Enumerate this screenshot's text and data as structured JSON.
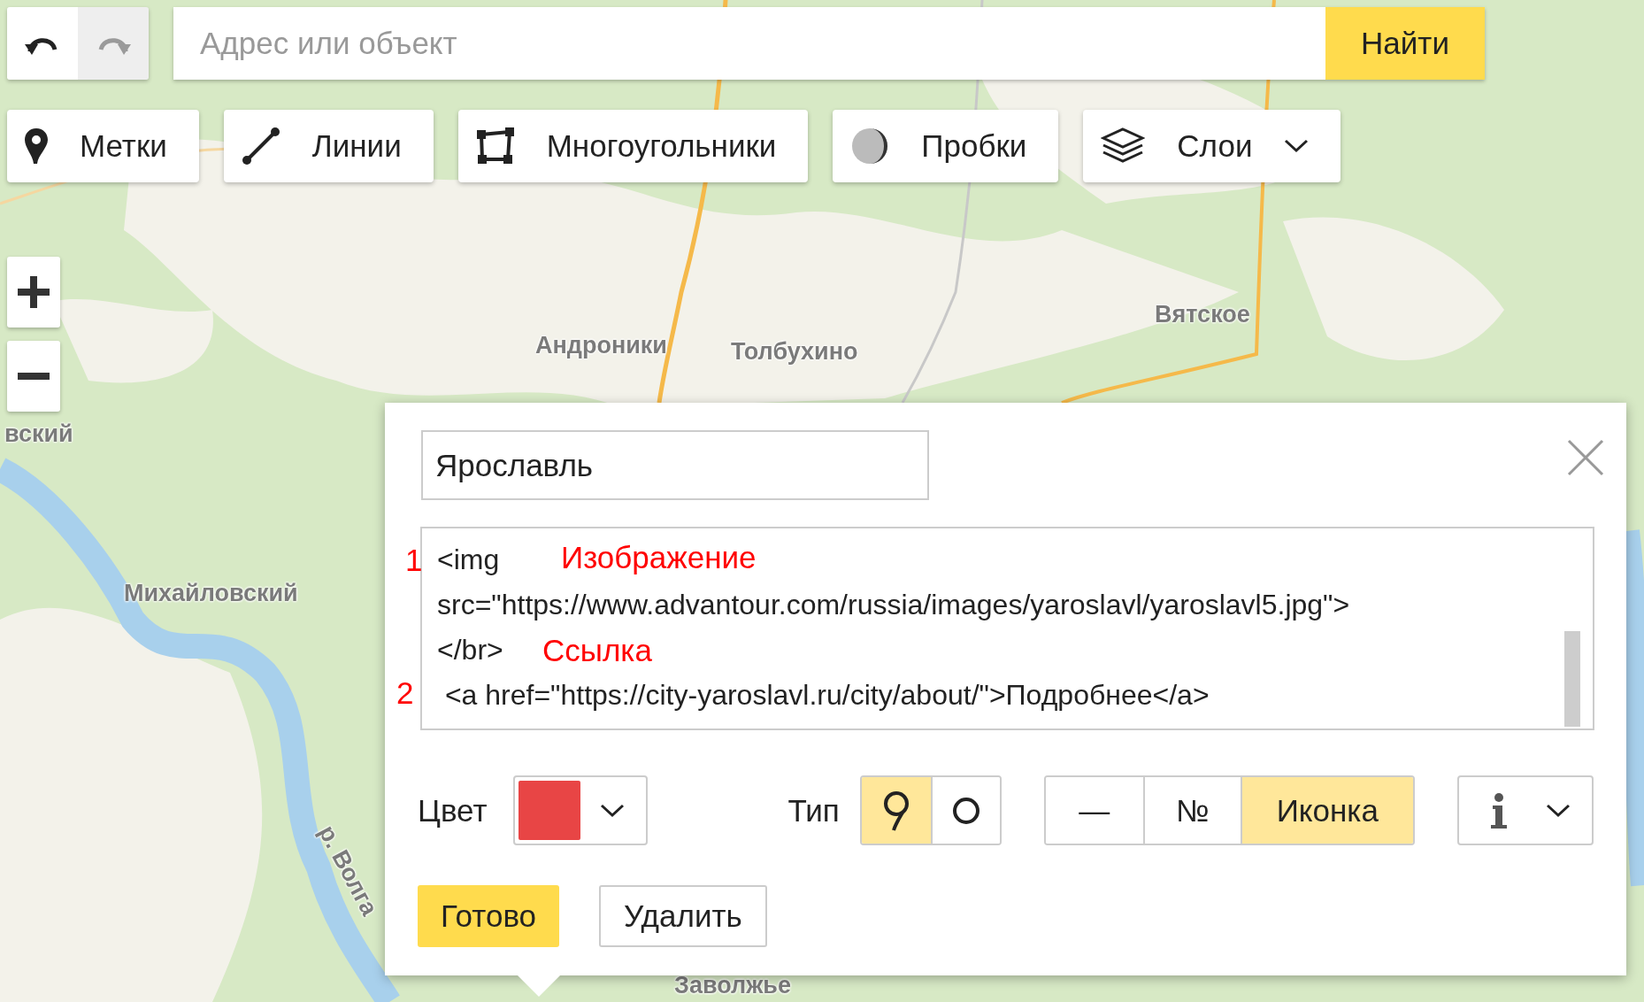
{
  "history_buttons": [
    {
      "kind": "undo",
      "disabled": false
    },
    {
      "kind": "redo",
      "disabled": true
    }
  ],
  "search": {
    "placeholder": "Адрес или объект",
    "button": "Найти"
  },
  "tools": [
    {
      "kind": "placemark",
      "label": "Метки"
    },
    {
      "kind": "line",
      "label": "Линии"
    },
    {
      "kind": "polygon",
      "label": "Многоугольники"
    },
    {
      "kind": "traffic",
      "label": "Пробки"
    },
    {
      "kind": "layers",
      "label": "Слои"
    }
  ],
  "map_labels": [
    {
      "text": "вский"
    },
    {
      "text": "Михайловский"
    },
    {
      "text": "р. Волга"
    },
    {
      "text": "Андроники"
    },
    {
      "text": "Толбухино"
    },
    {
      "text": "Вятское"
    },
    {
      "text": "Заволжье"
    }
  ],
  "editor": {
    "name": "Ярославль",
    "description_lines": [
      "<img",
      "src=\"https://www.advantour.com/russia/images/yaroslavl/yaroslavl5.jpg\">",
      "</br>",
      " <a href=\"https://city-yaroslavl.ru/city/about/\">Подробнее</a>"
    ],
    "annotations": [
      {
        "number": "1",
        "label": "Изображение"
      },
      {
        "number": "2",
        "label": "Ссылка"
      }
    ],
    "color_label": "Цвет",
    "color": "#e84545",
    "type_label": "Тип",
    "types": [
      {
        "kind": "pin",
        "selected": true
      },
      {
        "kind": "circle",
        "selected": false
      }
    ],
    "content_modes": [
      {
        "label": "—",
        "selected": false
      },
      {
        "label": "№",
        "selected": false
      },
      {
        "label": "Иконка",
        "selected": true
      }
    ],
    "buttons": [
      {
        "kind": "primary",
        "label": "Готово"
      },
      {
        "kind": "secondary",
        "label": "Удалить"
      }
    ]
  }
}
